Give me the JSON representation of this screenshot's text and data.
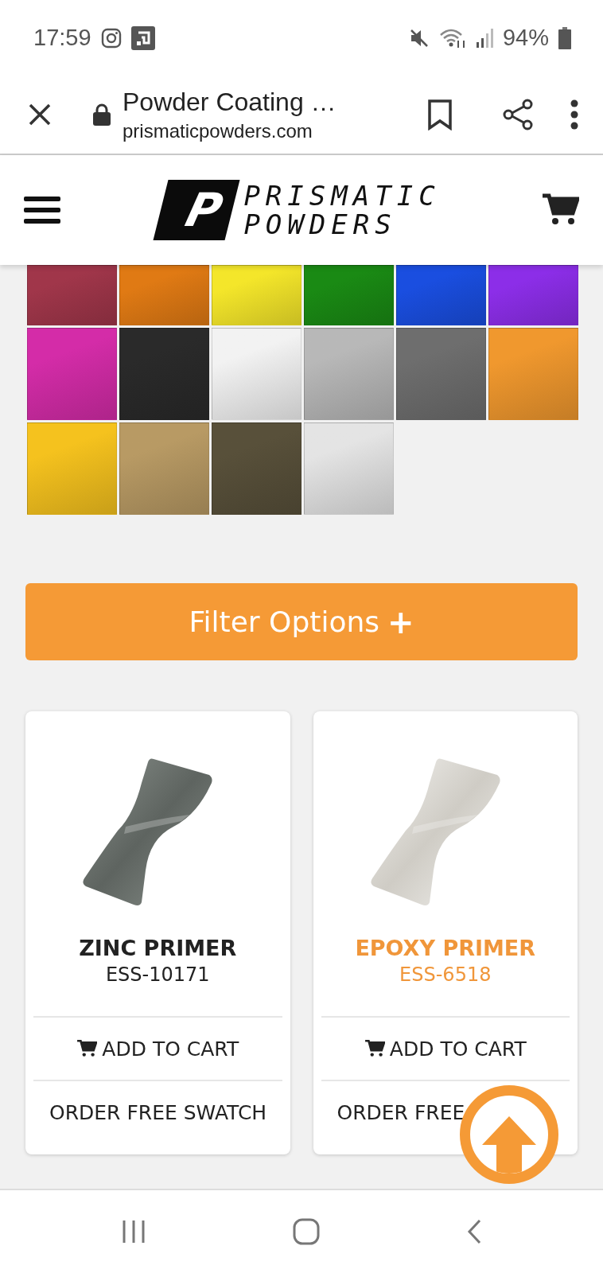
{
  "status_bar": {
    "time": "17:59",
    "battery": "94%"
  },
  "browser": {
    "title": "Powder Coating …",
    "url": "prismaticpowders.com"
  },
  "header": {
    "logo_mark": "P",
    "logo_lines": [
      "PRISMATIC",
      "POWDERS"
    ]
  },
  "swatches": [
    {
      "color": "#a0364a"
    },
    {
      "color": "#e07a14"
    },
    {
      "color": "#f4e62a"
    },
    {
      "color": "#1a8a14"
    },
    {
      "color": "#1a4ee0"
    },
    {
      "color": "#8c2ee8"
    },
    {
      "color": "#d42ca8"
    },
    {
      "color": "#2a2a2a"
    },
    {
      "color": "#f2f2f2"
    },
    {
      "color": "#b8b8b8"
    },
    {
      "color": "#6e6e6e"
    },
    {
      "color": "#f0982e"
    },
    {
      "color": "#f5c21e"
    },
    {
      "color": "#b89a64"
    },
    {
      "color": "#58503a"
    },
    {
      "color": "#e4e4e4"
    }
  ],
  "filter_button": {
    "label": "Filter Options",
    "icon": "+"
  },
  "products": [
    {
      "name": "ZINC PRIMER",
      "code": "ESS-10171",
      "selected": false,
      "add_label": "ADD TO CART",
      "swatch_label": "ORDER FREE SWATCH"
    },
    {
      "name": "EPOXY PRIMER",
      "code": "ESS-6518",
      "selected": true,
      "add_label": "ADD TO CART",
      "swatch_label": "ORDER FREE"
    }
  ]
}
